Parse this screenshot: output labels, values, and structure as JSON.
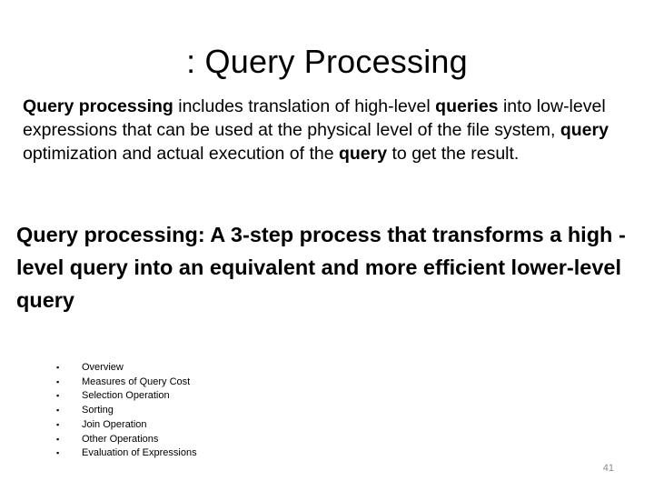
{
  "slide": {
    "title": ":  Query Processing",
    "intro": [
      {
        "text": "Query processing",
        "bold": true
      },
      {
        "text": " includes translation of high-level ",
        "bold": false
      },
      {
        "text": "queries",
        "bold": true
      },
      {
        "text": " into low-level expressions that can be used at the physical level of the file system, ",
        "bold": false
      },
      {
        "text": "query",
        "bold": true
      },
      {
        "text": " optimization and actual execution of the ",
        "bold": false
      },
      {
        "text": "query",
        "bold": true
      },
      {
        "text": " to get the result.",
        "bold": false
      }
    ],
    "definition": "Query processing: A 3-step process that transforms a high -level query into an equivalent and more efficient lower-level query",
    "topics": [
      "Overview",
      "Measures of Query Cost",
      "Selection Operation",
      "Sorting",
      "Join Operation",
      "Other Operations",
      "Evaluation of Expressions"
    ],
    "bullet_glyph": "▪",
    "page_number": "41"
  }
}
